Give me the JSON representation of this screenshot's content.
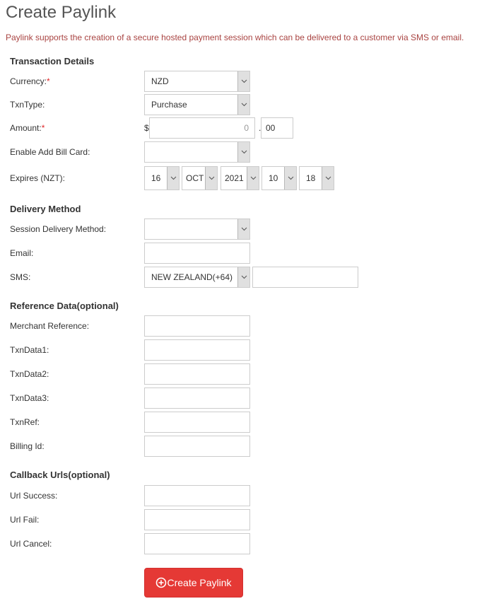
{
  "page": {
    "title": "Create Paylink",
    "intro": "Paylink supports the creation of a secure hosted payment session which can be delivered to a customer via SMS or email."
  },
  "transaction": {
    "heading": "Transaction Details",
    "currency_label": "Currency:",
    "currency_value": "NZD",
    "txntype_label": "TxnType:",
    "txntype_value": "Purchase",
    "amount_label": "Amount:",
    "currency_symbol": "$",
    "amount_placeholder": "0",
    "decimal_separator": ".",
    "cents_value": "00",
    "bill_card_label": "Enable Add Bill Card:",
    "bill_card_value": "",
    "expires_label": "Expires (NZT):",
    "expires": {
      "day": "16",
      "month": "OCT",
      "year": "2021",
      "hour": "10",
      "minute": "18"
    },
    "required_mark": "*"
  },
  "delivery": {
    "heading": "Delivery Method",
    "method_label": "Session Delivery Method:",
    "method_value": "",
    "email_label": "Email:",
    "email_value": "",
    "sms_label": "SMS:",
    "sms_country": "NEW ZEALAND(+64)",
    "sms_number": ""
  },
  "reference": {
    "heading": "Reference Data(optional)",
    "fields": [
      {
        "label": "Merchant Reference:",
        "value": ""
      },
      {
        "label": "TxnData1:",
        "value": ""
      },
      {
        "label": "TxnData2:",
        "value": ""
      },
      {
        "label": "TxnData3:",
        "value": ""
      },
      {
        "label": "TxnRef:",
        "value": ""
      },
      {
        "label": "Billing Id:",
        "value": ""
      }
    ]
  },
  "callbacks": {
    "heading": "Callback Urls(optional)",
    "fields": [
      {
        "label": "Url Success:",
        "value": ""
      },
      {
        "label": "Url Fail:",
        "value": ""
      },
      {
        "label": "Url Cancel:",
        "value": ""
      }
    ]
  },
  "actions": {
    "create_label": "Create Paylink",
    "create_icon": "plus-circle-icon",
    "create_color": "#e53935"
  }
}
